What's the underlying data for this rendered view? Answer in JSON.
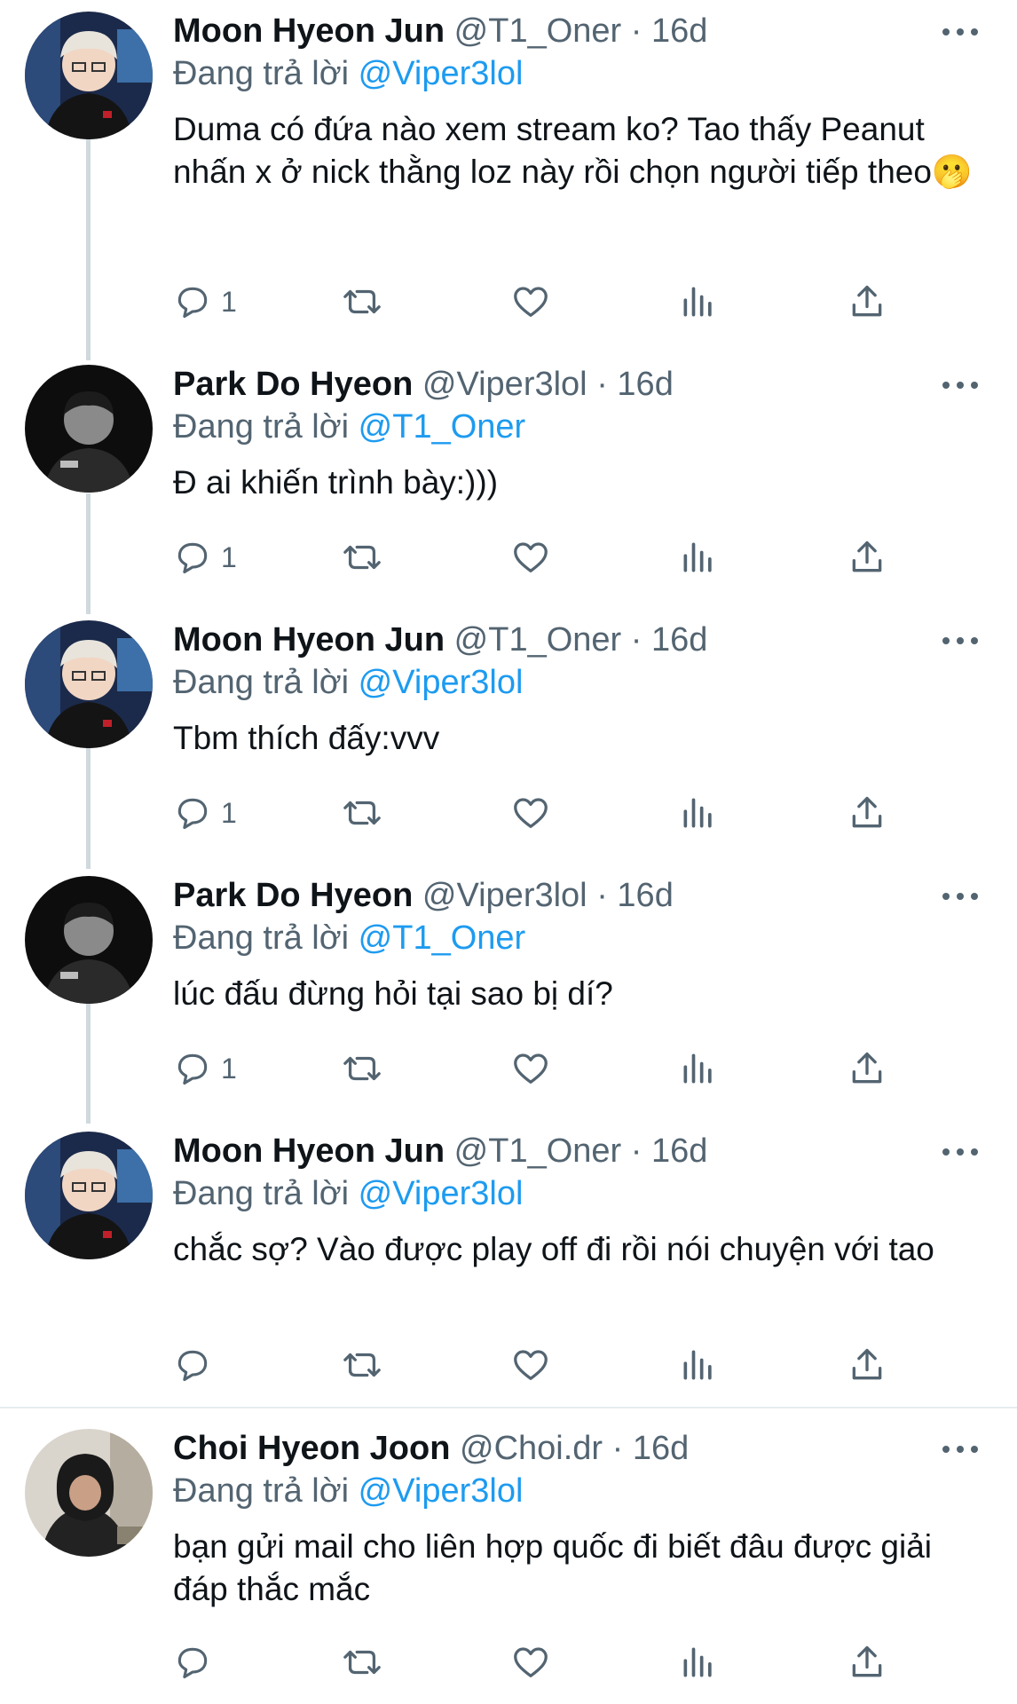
{
  "colors": {
    "link": "#1d9bf0",
    "muted": "#536471",
    "text": "#0f1419",
    "thread_line": "#cfd9de"
  },
  "icons": [
    "reply-icon",
    "retweet-icon",
    "like-icon",
    "views-icon",
    "share-icon",
    "more-icon"
  ],
  "tweets": [
    {
      "name": "Moon Hyeon Jun",
      "handle": "@T1_Oner",
      "sep": "·",
      "time": "16d",
      "replying_prefix": "Đang trả lời",
      "replying_to": "@Viper3lol",
      "body": "Duma có đứa nào xem stream ko? Tao thấy Peanut nhấn x ở nick thằng loz này rồi chọn người tiếp theo🫢",
      "reply_count": "1"
    },
    {
      "name": "Park Do Hyeon",
      "handle": "@Viper3lol",
      "sep": "·",
      "time": "16d",
      "replying_prefix": "Đang trả lời",
      "replying_to": "@T1_Oner",
      "body": "Đ ai khiến trình bày:)))",
      "reply_count": "1"
    },
    {
      "name": "Moon Hyeon Jun",
      "handle": "@T1_Oner",
      "sep": "·",
      "time": "16d",
      "replying_prefix": "Đang trả lời",
      "replying_to": "@Viper3lol",
      "body": "Tbm thích đấy:vvv",
      "reply_count": "1"
    },
    {
      "name": "Park Do Hyeon",
      "handle": "@Viper3lol",
      "sep": "·",
      "time": "16d",
      "replying_prefix": "Đang trả lời",
      "replying_to": "@T1_Oner",
      "body": "lúc đấu đừng hỏi tại sao bị dí?",
      "reply_count": "1"
    },
    {
      "name": "Moon Hyeon Jun",
      "handle": "@T1_Oner",
      "sep": "·",
      "time": "16d",
      "replying_prefix": "Đang trả lời",
      "replying_to": "@Viper3lol",
      "body": "chắc sợ? Vào được play off đi rồi nói chuyện với tao",
      "reply_count": ""
    },
    {
      "name": "Choi Hyeon Joon",
      "handle": "@Choi.dr",
      "sep": "·",
      "time": "16d",
      "replying_prefix": "Đang trả lời",
      "replying_to": "@Viper3lol",
      "body": "bạn gửi mail cho liên hợp quốc đi biết đâu được giải đáp thắc mắc",
      "reply_count": ""
    }
  ]
}
